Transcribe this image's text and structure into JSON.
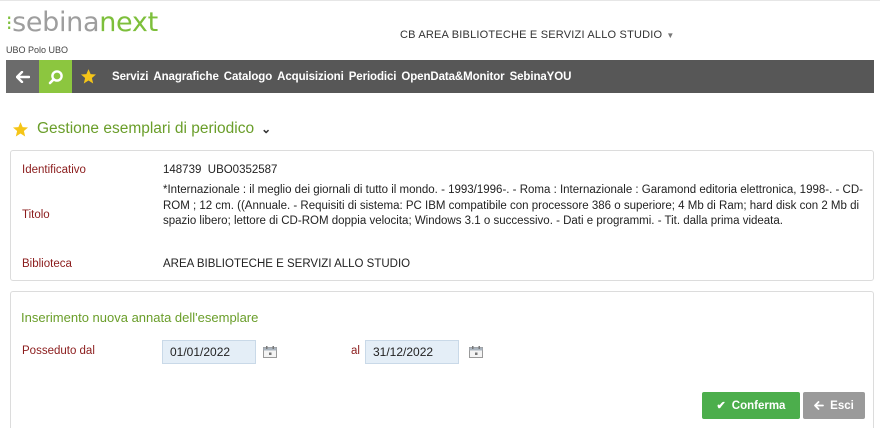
{
  "header": {
    "logo_part1": "sebina",
    "logo_part2": "next",
    "polo_label": "UBO Polo UBO",
    "area_selector": "CB AREA BIBLIOTECHE E SERVIZI ALLO STUDIO"
  },
  "navbar": {
    "items": [
      "Servizi",
      "Anagrafiche",
      "Catalogo",
      "Acquisizioni",
      "Periodici",
      "OpenData&Monitor",
      "SebinaYOU"
    ]
  },
  "page": {
    "title": "Gestione esemplari di periodico"
  },
  "record": {
    "identificativo_label": "Identificativo",
    "identificativo_value": "148739  UBO0352587",
    "titolo_label": "Titolo",
    "titolo_value": "*Internazionale : il meglio dei giornali di tutto il mondo. - 1993/1996-. - Roma : Internazionale : Garamond editoria elettronica, 1998-. - CD-ROM ; 12 cm. ((Annuale. - Requisiti di sistema: PC IBM compatibile con processore 386 o superiore; 4 Mb di Ram; hard disk con 2 Mb di spazio libero; lettore di CD-ROM doppia velocita; Windows 3.1 o successivo. - Dati e programmi. - Tit. dalla prima videata.",
    "biblioteca_label": "Biblioteca",
    "biblioteca_value": "AREA BIBLIOTECHE E SERVIZI ALLO STUDIO"
  },
  "form": {
    "section_title": "Inserimento nuova annata dell'esemplare",
    "posseduto_label": "Posseduto dal",
    "date_from": "01/01/2022",
    "al_label": "al",
    "date_to": "31/12/2022",
    "confirm_label": "Conferma",
    "exit_label": "Esci"
  },
  "colors": {
    "accent_green": "#8cc63f",
    "title_green": "#6a9e2a",
    "label_red": "#8b1c1c",
    "navbar_gray": "#575757",
    "star_yellow": "#f5c518",
    "confirm_green": "#4cae4c"
  }
}
